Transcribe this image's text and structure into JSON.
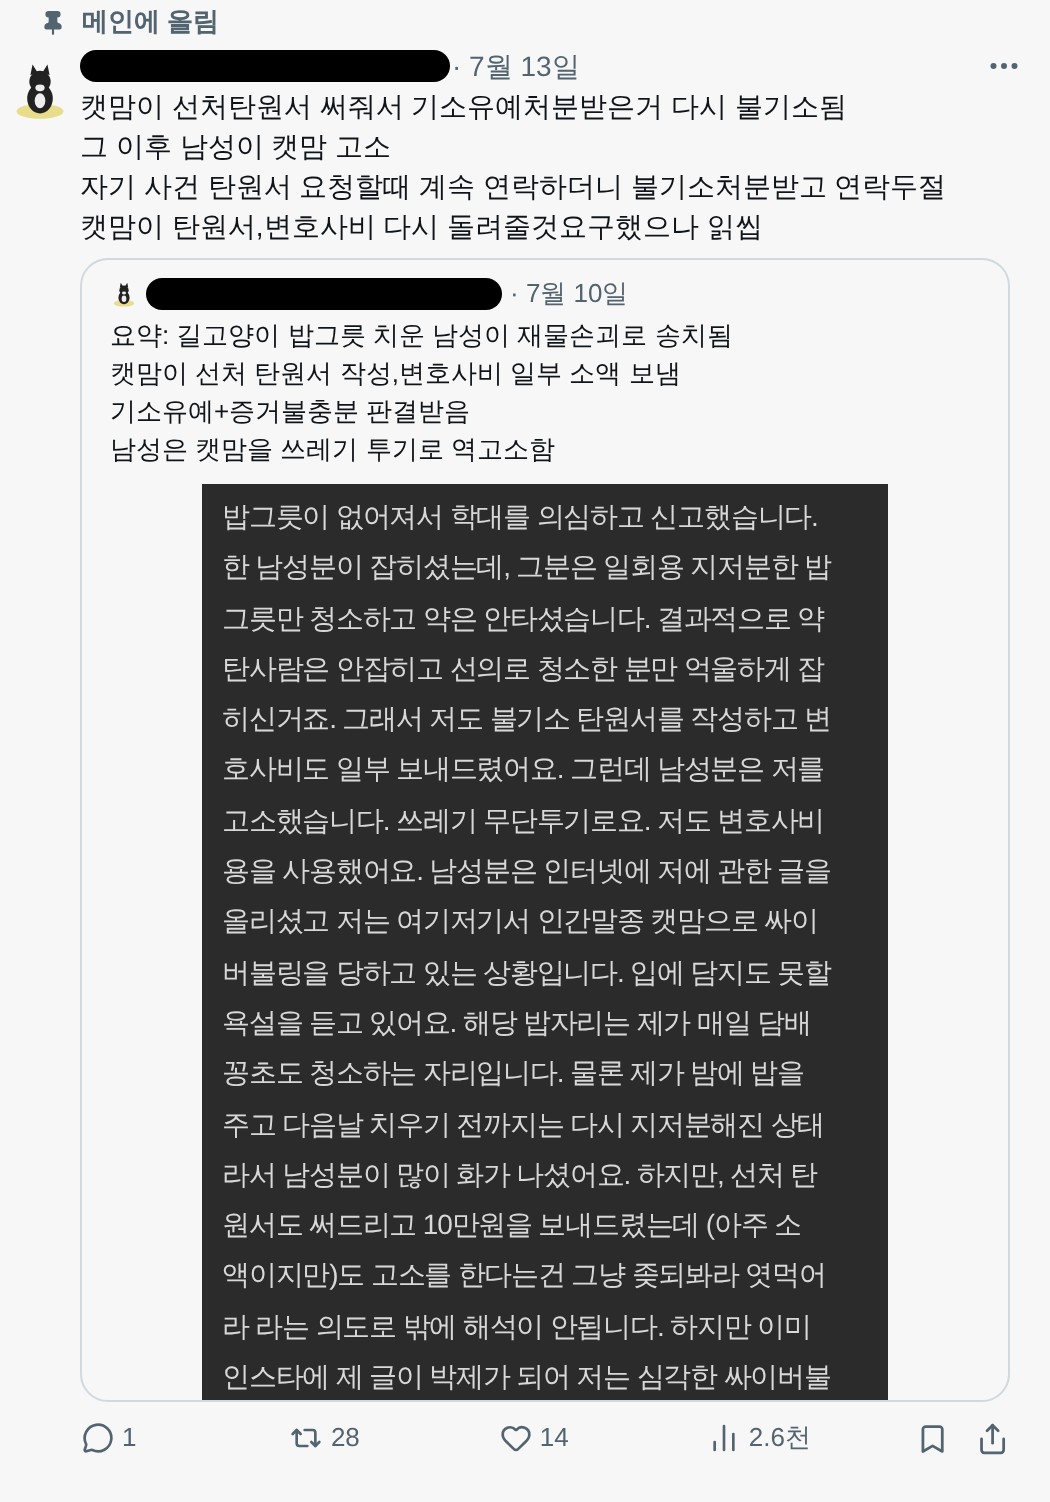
{
  "pinned": {
    "label": "메인에 올림"
  },
  "post": {
    "date": "· 7월 13일",
    "lines": [
      "캣맘이 선처탄원서 써줘서 기소유예처분받은거 다시 불기소됨",
      "그 이후 남성이 캣맘 고소",
      "자기 사건 탄원서 요청할때 계속 연락하더니 불기소처분받고 연락두절",
      "캣맘이 탄원서,변호사비 다시 돌려줄것요구했으나 읽씹"
    ]
  },
  "quote": {
    "date": "· 7월 10일",
    "lines": [
      "요약: 길고양이 밥그릇 치운 남성이 재물손괴로 송치됨",
      "캣맘이 선처 탄원서 작성,변호사비 일부 소액 보냄",
      "기소유예+증거불충분 판결받음",
      "남성은 캣맘을 쓰레기 투기로 역고소함"
    ],
    "image_lines": [
      "밥그릇이 없어져서 학대를 의심하고 신고했습니다.",
      "한 남성분이 잡히셨는데, 그분은 일회용 지저분한 밥",
      "그릇만 청소하고 약은 안타셨습니다. 결과적으로 약",
      "탄사람은 안잡히고 선의로 청소한 분만 억울하게 잡",
      "히신거죠. 그래서 저도 불기소 탄원서를 작성하고 변",
      "호사비도 일부 보내드렸어요. 그런데 남성분은 저를",
      "고소했습니다. 쓰레기 무단투기로요. 저도 변호사비",
      "용을 사용했어요. 남성분은 인터넷에 저에 관한 글을",
      "올리셨고 저는 여기저기서 인간말종 캣맘으로 싸이",
      "버불링을 당하고 있는 상황입니다. 입에 담지도 못할",
      "욕설을 듣고 있어요. 해당 밥자리는 제가 매일 담배",
      "꽁초도 청소하는 자리입니다. 물론 제가 밤에 밥을",
      "주고 다음날 치우기 전까지는 다시 지저분해진 상태",
      "라서 남성분이 많이 화가 나셨어요. 하지만, 선처 탄",
      "원서도 써드리고 10만원을 보내드렸는데 (아주 소",
      "액이지만)도 고소를 한다는건 그냥 좆되봐라 엿먹어",
      "라 라는 의도로 밖에 해석이 안됩니다. 하지만 이미",
      "인스타에 제 글이 박제가 되어 저는 심각한 싸이버불"
    ]
  },
  "actions": [
    {
      "kind": "reply",
      "count": "1"
    },
    {
      "kind": "repost",
      "count": "28"
    },
    {
      "kind": "like",
      "count": "14"
    },
    {
      "kind": "views",
      "count": "2.6천"
    }
  ]
}
